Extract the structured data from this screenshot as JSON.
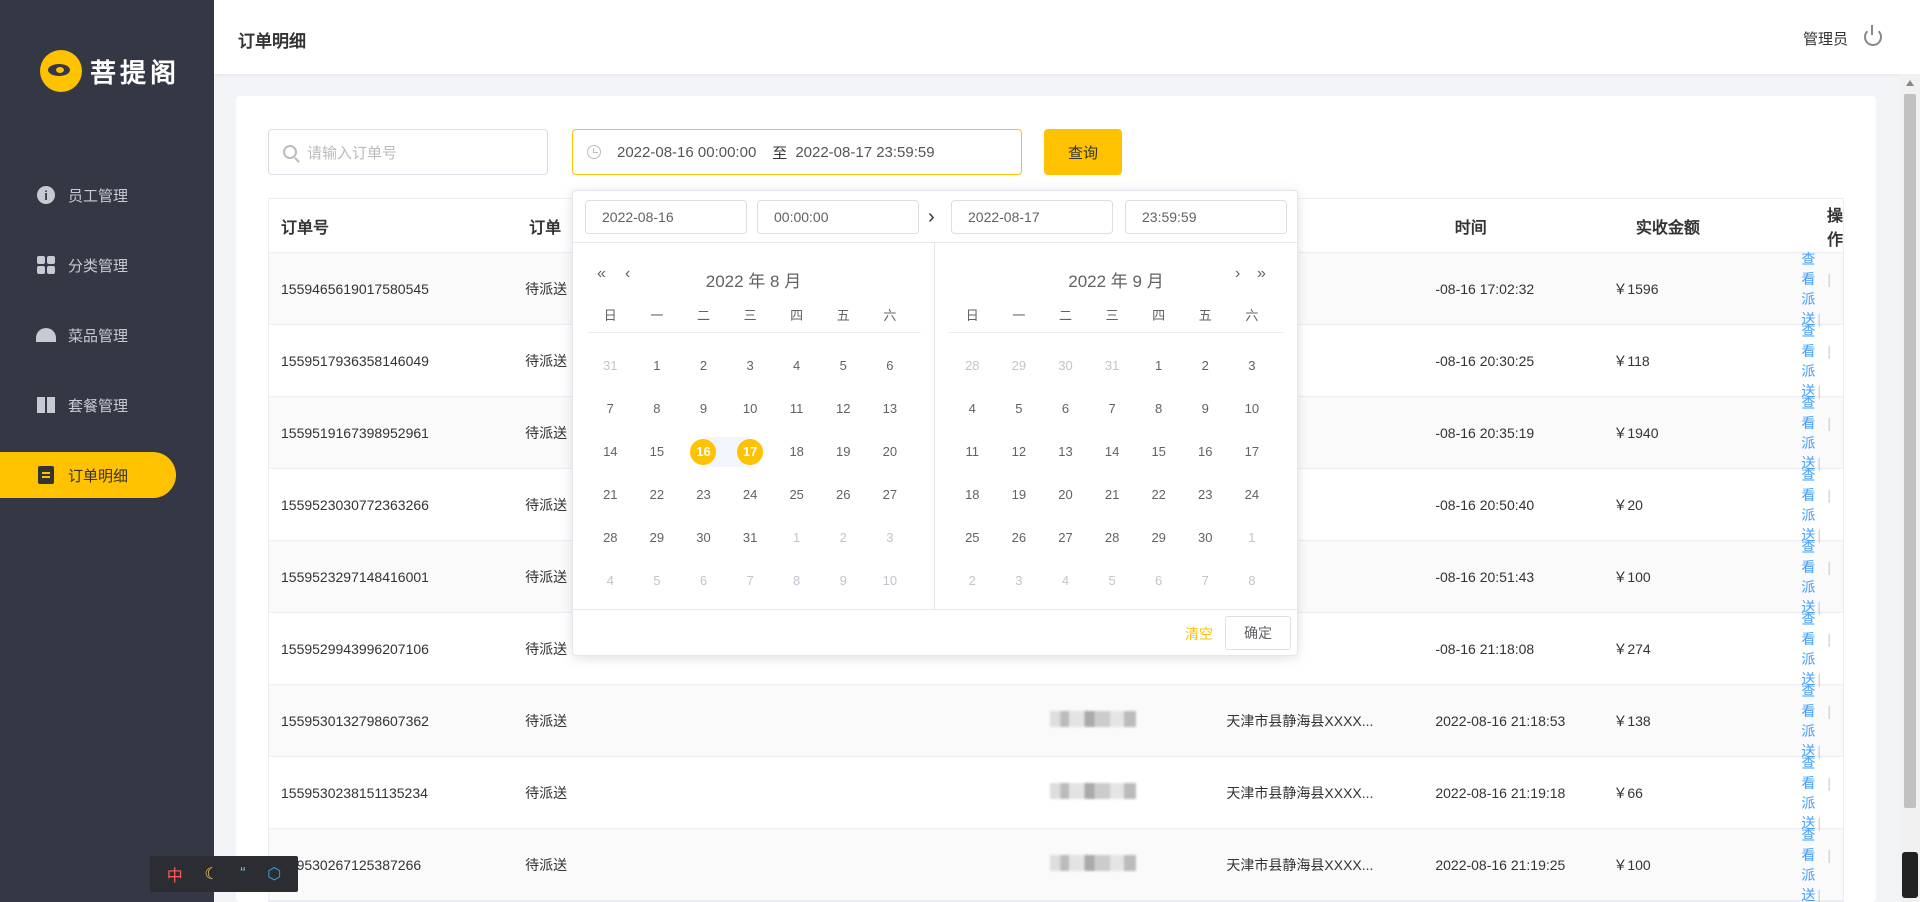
{
  "brand": {
    "name": "菩提阁"
  },
  "sidebar": {
    "items": [
      {
        "label": "员工管理",
        "icon": "info-icon"
      },
      {
        "label": "分类管理",
        "icon": "grid-icon"
      },
      {
        "label": "菜品管理",
        "icon": "bell-icon"
      },
      {
        "label": "套餐管理",
        "icon": "gift-icon"
      },
      {
        "label": "订单明细",
        "icon": "clipboard-icon",
        "active": true
      }
    ]
  },
  "header": {
    "title": "订单明细",
    "user": "管理员"
  },
  "filters": {
    "search_placeholder": "请输入订单号",
    "range_start": "2022-08-16 00:00:00",
    "range_sep": "至",
    "range_end": "2022-08-17 23:59:59",
    "query_label": "查询"
  },
  "table": {
    "headers": [
      "订单号",
      "订单状态",
      "",
      "",
      "",
      "下单时间",
      "实收金额",
      "操作"
    ],
    "header_c1": "订单号",
    "header_c2": "订单",
    "header_c6": "时间",
    "header_c7": "实收金额",
    "header_c8": "操作",
    "rows": [
      {
        "id": "1559465619017580545",
        "status": "待派送",
        "address": "",
        "time": "-08-16 17:02:32",
        "amount": "￥1596"
      },
      {
        "id": "1559517936358146049",
        "status": "待派送",
        "address": "",
        "time": "-08-16 20:30:25",
        "amount": "￥118"
      },
      {
        "id": "1559519167398952961",
        "status": "待派送",
        "address": "",
        "time": "-08-16 20:35:19",
        "amount": "￥1940"
      },
      {
        "id": "1559523030772363266",
        "status": "待派送",
        "address": "",
        "time": "-08-16 20:50:40",
        "amount": "￥20"
      },
      {
        "id": "1559523297148416001",
        "status": "待派送",
        "address": "",
        "time": "-08-16 20:51:43",
        "amount": "￥100"
      },
      {
        "id": "1559529943996207106",
        "status": "待派送",
        "address": "",
        "time": "-08-16 21:18:08",
        "amount": "￥274"
      },
      {
        "id": "1559530132798607362",
        "status": "待派送",
        "address": "天津市县静海县XXXX...",
        "time": "2022-08-16 21:18:53",
        "amount": "￥138"
      },
      {
        "id": "1559530238151135234",
        "status": "待派送",
        "address": "天津市县静海县XXXX...",
        "time": "2022-08-16 21:19:18",
        "amount": "￥66"
      },
      {
        "id": "559530267125387266",
        "status": "待派送",
        "address": "天津市县静海县XXXX...",
        "time": "2022-08-16 21:19:25",
        "amount": "￥100"
      }
    ],
    "view_label": "查看",
    "dispatch_label": "派送"
  },
  "picker": {
    "start_date": "2022-08-16",
    "start_time": "00:00:00",
    "end_date": "2022-08-17",
    "end_time": "23:59:59",
    "left_title": "2022 年 8 月",
    "right_title": "2022 年 9 月",
    "weekdays": [
      "日",
      "一",
      "二",
      "三",
      "四",
      "五",
      "六"
    ],
    "left_weeks": [
      [
        "31",
        "1",
        "2",
        "3",
        "4",
        "5",
        "6"
      ],
      [
        "7",
        "8",
        "9",
        "10",
        "11",
        "12",
        "13"
      ],
      [
        "14",
        "15",
        "16",
        "17",
        "18",
        "19",
        "20"
      ],
      [
        "21",
        "22",
        "23",
        "24",
        "25",
        "26",
        "27"
      ],
      [
        "28",
        "29",
        "30",
        "31",
        "1",
        "2",
        "3"
      ],
      [
        "4",
        "5",
        "6",
        "7",
        "8",
        "9",
        "10"
      ]
    ],
    "right_weeks": [
      [
        "28",
        "29",
        "30",
        "31",
        "1",
        "2",
        "3"
      ],
      [
        "4",
        "5",
        "6",
        "7",
        "8",
        "9",
        "10"
      ],
      [
        "11",
        "12",
        "13",
        "14",
        "15",
        "16",
        "17"
      ],
      [
        "18",
        "19",
        "20",
        "21",
        "22",
        "23",
        "24"
      ],
      [
        "25",
        "26",
        "27",
        "28",
        "29",
        "30",
        "1"
      ],
      [
        "2",
        "3",
        "4",
        "5",
        "6",
        "7",
        "8"
      ]
    ],
    "clear_label": "清空",
    "confirm_label": "确定"
  },
  "ime": {
    "mode": "中"
  },
  "colors": {
    "accent": "#ffc200",
    "sidebar": "#343744",
    "link": "#419eff"
  }
}
